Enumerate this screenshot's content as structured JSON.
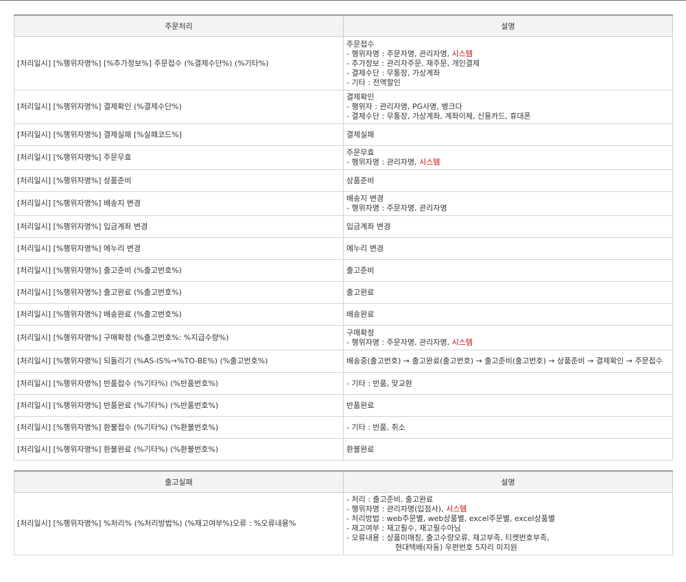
{
  "table1": {
    "headers": [
      "주문처리",
      "설명"
    ],
    "rows": [
      {
        "left": "[처리일시] [%행위자명%] [%추가정보%] 주문접수 (%결제수단%) (%기타%)",
        "right": [
          {
            "text": "주문접수"
          },
          {
            "text": "- 행위자명 : 주문자명, 관리자명, ",
            "red": "시스템"
          },
          {
            "text": "- 추가정보 : 관리자주문, 재주문, 개인결제"
          },
          {
            "text": "- 결제수단 : 무통장, 가상계좌"
          },
          {
            "text": "- 기타 : 전액할인"
          }
        ]
      },
      {
        "left": "[처리일시] [%행위자명%] 결제확인 (%결제수단%)",
        "right": [
          {
            "text": "결제확인"
          },
          {
            "text": "- 행위자 : 관리자명, PG사명, 뱅크다"
          },
          {
            "text": "- 결제수단 : 무통장, 가상계좌, 계좌이체, 신용카드, 휴대폰"
          }
        ]
      },
      {
        "left": "[처리일시] [%행위자명%] 결제실패 [%실패코드%]",
        "right": [
          {
            "text": "결제실패"
          }
        ]
      },
      {
        "left": "[처리일시] [%행위자명%] 주문무효",
        "right": [
          {
            "text": "주문무효"
          },
          {
            "text": "- 행위자명 : 관리자명, ",
            "red": "시스템"
          }
        ]
      },
      {
        "left": "[처리일시] [%행위자명%] 상품준비",
        "right": [
          {
            "text": "상품준비"
          }
        ]
      },
      {
        "left": "[처리일시] [%행위자명%] 배송지 변경",
        "right": [
          {
            "text": "배송지 변경"
          },
          {
            "text": "- 행위자명 : 주문자명, 관리자명"
          }
        ]
      },
      {
        "left": "[처리일시] [%행위자명%] 입금계좌 변경",
        "right": [
          {
            "text": "입금계좌 변경"
          }
        ]
      },
      {
        "left": "[처리일시] [%행위자명%] 에누리 변경",
        "right": [
          {
            "text": "에누리 변경"
          }
        ]
      },
      {
        "left": "[처리일시] [%행위자명%] 출고준비 (%출고번호%)",
        "right": [
          {
            "text": "출고준비"
          }
        ]
      },
      {
        "left": "[처리일시] [%행위자명%] 출고완료 (%출고번호%)",
        "right": [
          {
            "text": "출고완료"
          }
        ]
      },
      {
        "left": "[처리일시] [%행위자명%] 배송완료 (%출고번호%)",
        "right": [
          {
            "text": "배송완료"
          }
        ]
      },
      {
        "left": "[처리일시] [%행위자명%] 구매확정 (%출고번호%: %지급수량%)",
        "right": [
          {
            "text": "구매확정"
          },
          {
            "text": "- 행위자명 : 주문자명, 관리자명, ",
            "red": "시스템"
          }
        ]
      },
      {
        "left": "[처리일시] [%행위자명%] 되돌리기 (%AS-IS%→%TO-BE%) (%출고번호%)",
        "right": [
          {
            "text": "배송중(출고번호) → 출고완료(출고번호) → 출고준비(출고번호) → 상품준비 → 결제확인 → 주문접수",
            "wrap": true
          }
        ]
      },
      {
        "left": "[처리일시] [%행위자명%] 반품접수 (%기타%) (%반품번호%)",
        "right": [
          {
            "text": "- 기타 : 반품, 맞교환"
          }
        ]
      },
      {
        "left": "[처리일시] [%행위자명%] 반품완료 (%기타%) (%반품번호%)",
        "right": [
          {
            "text": "반품완료"
          }
        ]
      },
      {
        "left": "[처리일시] [%행위자명%] 환불접수 (%기타%) (%환불번호%)",
        "right": [
          {
            "text": "- 기타 : 반품, 취소"
          }
        ]
      },
      {
        "left": "[처리일시] [%행위자명%] 환불완료 (%기타%) (%환불번호%)",
        "right": [
          {
            "text": "환불완료"
          }
        ]
      }
    ]
  },
  "table2": {
    "headers": [
      "출고실패",
      "설명"
    ],
    "rows": [
      {
        "left": "[처리일시] [%행위자명%] %처리% (%처리방법%) (%재고여부%)오류 : %오류내용%",
        "right": [
          {
            "text": "- 처리 : 출고준비, 출고완료"
          },
          {
            "text": "- 행위자명 : 관리자명(입점사), ",
            "red": "시스템"
          },
          {
            "text": "- 처리방법 : web주문별, web상품별, excel주문별, excel상품별"
          },
          {
            "text": "- 재고여부 : 재고필수, 재고필수아님"
          },
          {
            "text": "- 오류내용 : 상품미매칭, 출고수량오류, 재고부족, 티켓번호부족,"
          },
          {
            "text": "현대택배(자동) 우편번호 5자리 미지원",
            "indent": true
          }
        ]
      }
    ]
  }
}
